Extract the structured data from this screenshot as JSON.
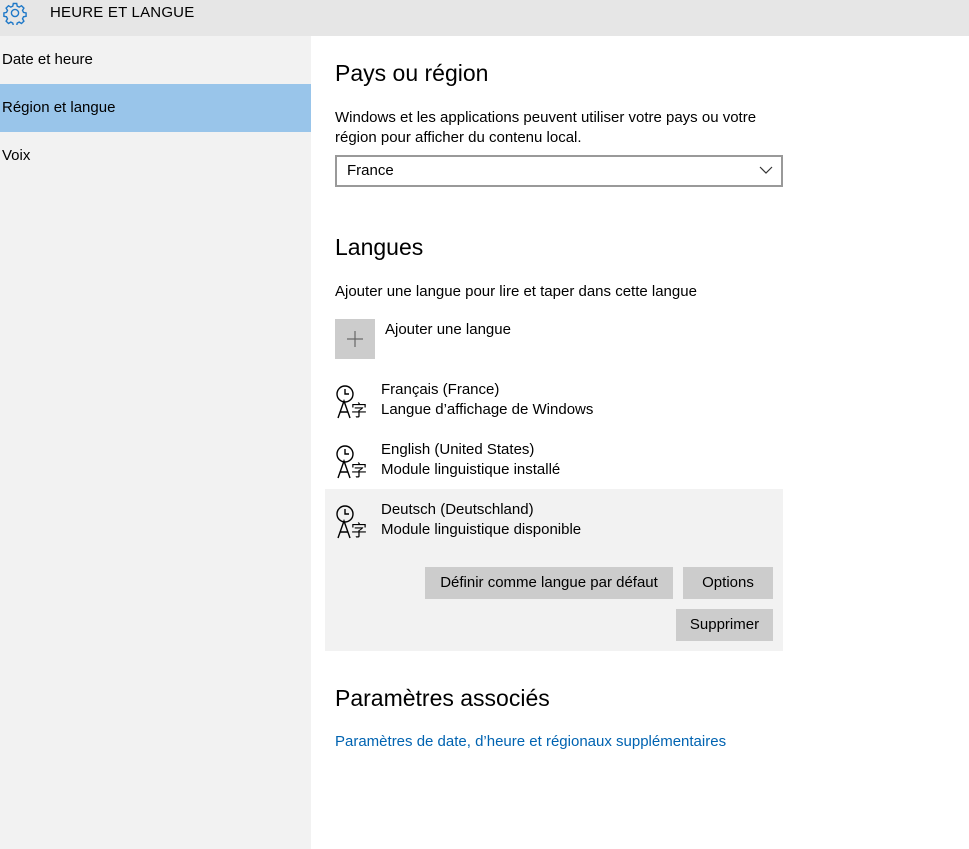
{
  "window": {
    "title": "HEURE ET LANGUE",
    "icon": "gear-icon"
  },
  "sidebar": {
    "items": [
      {
        "label": "Date et heure",
        "selected": false
      },
      {
        "label": "Région et langue",
        "selected": true
      },
      {
        "label": "Voix",
        "selected": false
      }
    ],
    "selected_color": "#99c5ea"
  },
  "region": {
    "heading": "Pays ou région",
    "description_line1": "Windows et les applications peuvent utiliser votre pays ou votre",
    "description_line2": "région pour afficher du contenu local.",
    "selected_country": "France"
  },
  "languages": {
    "heading": "Langues",
    "description": "Ajouter une langue pour lire et taper dans cette langue",
    "add_label": "Ajouter une langue",
    "items": [
      {
        "name": "Français (France)",
        "status": "Langue d’affichage de Windows"
      },
      {
        "name": "English (United States)",
        "status": "Module linguistique installé"
      },
      {
        "name": "Deutsch (Deutschland)",
        "status": "Module linguistique disponible"
      }
    ],
    "actions": {
      "set_default": "Définir comme langue par défaut",
      "options": "Options",
      "remove": "Supprimer"
    }
  },
  "related": {
    "heading": "Paramètres associés",
    "link": "Paramètres de date, d’heure et régionaux supplémentaires",
    "link_color": "#0063b1"
  }
}
